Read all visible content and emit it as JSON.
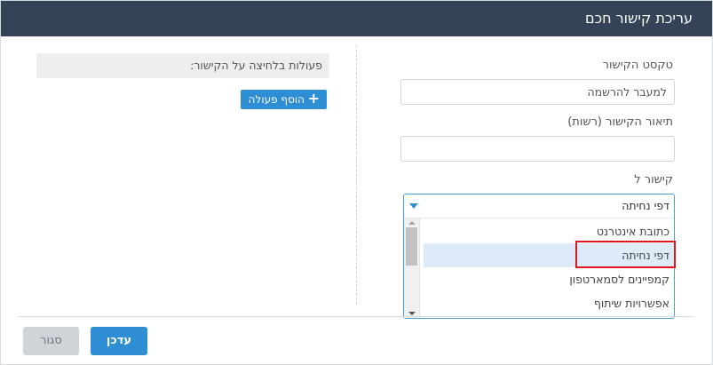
{
  "dialog": {
    "title": "עריכת קישור חכם"
  },
  "form": {
    "link_text_label": "טקסט הקישור",
    "link_text_value": "למעבר להרשמה",
    "link_desc_label": "תיאור הקישור (רשות)",
    "link_desc_value": "",
    "link_to_label": "קישור ל",
    "link_to_selected": "דפי נחיתה",
    "link_to_options": [
      "כתובת אינטרנט",
      "דפי נחיתה",
      "קמפיינים לסמארטפון",
      "אפשרויות שיתוף"
    ]
  },
  "actions": {
    "header": "פעולות בלחיצה על הקישור:",
    "add_button": "הוסף פעולה"
  },
  "footer": {
    "save_label": "עדכן",
    "close_label": "סגור"
  },
  "colors": {
    "titlebar": "#344358",
    "accent": "#2f8dd3",
    "highlight": "#e0161d"
  }
}
